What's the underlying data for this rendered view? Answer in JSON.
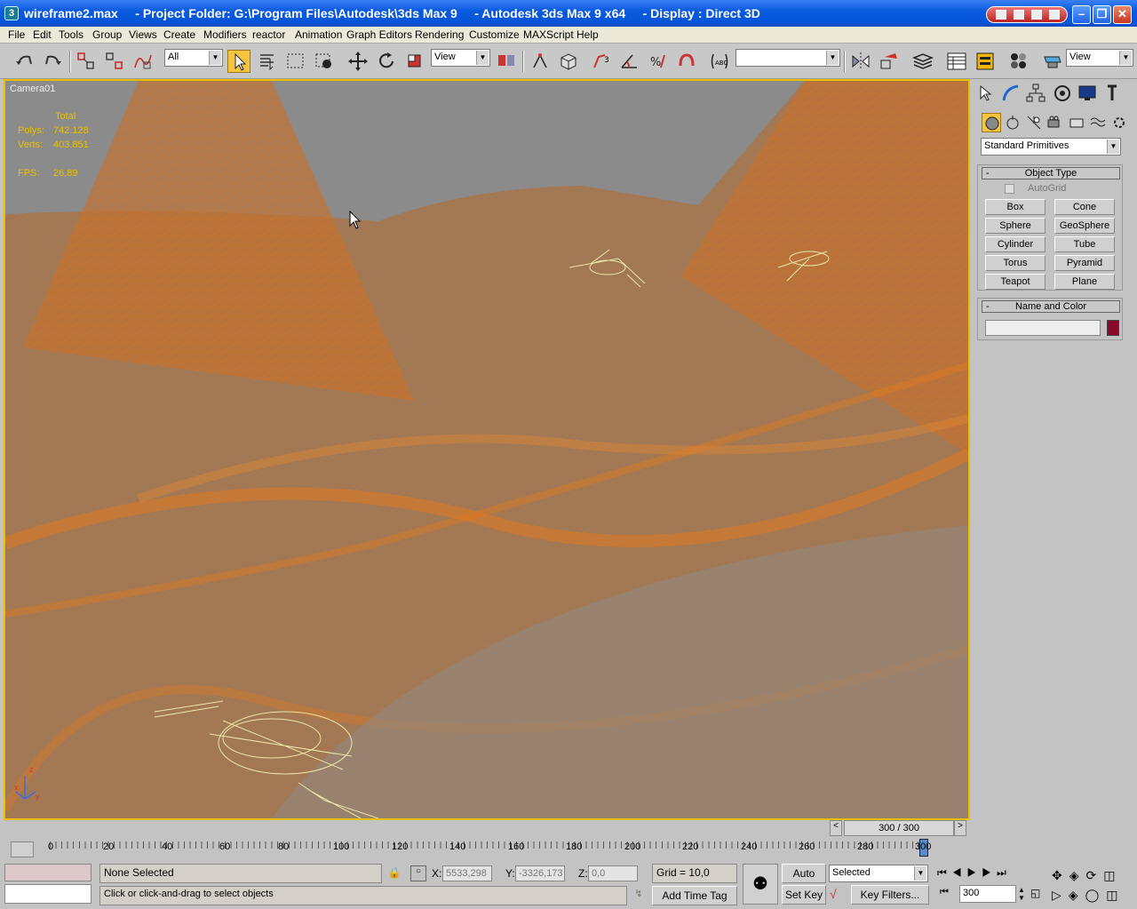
{
  "window": {
    "title": "wireframe2.max     - Project Folder: G:\\Program Files\\Autodesk\\3ds Max 9     - Autodesk 3ds Max 9 x64     - Display : Direct 3D"
  },
  "menu": [
    "File",
    "Edit",
    "Tools",
    "Group",
    "Views",
    "Create",
    "Modifiers",
    "reactor",
    "Animation",
    "Graph Editors",
    "Rendering",
    "Customize",
    "MAXScript",
    "Help"
  ],
  "toolbar": {
    "selection_filter": "All",
    "reference_coord": "View",
    "named_selection": "",
    "viewport_dropdown": "View"
  },
  "viewport": {
    "label": "Camera01",
    "stats": {
      "header": "Total",
      "polys_label": "Polys:",
      "polys_value": "742.128",
      "verts_label": "Verts:",
      "verts_value": "403.851",
      "fps_label": "FPS:",
      "fps_value": "26,89"
    },
    "axis": {
      "z": "z",
      "x": "x",
      "y": "y"
    }
  },
  "command_panel": {
    "category": "Standard Primitives",
    "object_type_header": "Object Type",
    "autogrid": "AutoGrid",
    "buttons": [
      "Box",
      "Cone",
      "Sphere",
      "GeoSphere",
      "Cylinder",
      "Tube",
      "Torus",
      "Pyramid",
      "Teapot",
      "Plane"
    ],
    "name_color_header": "Name and Color",
    "name_value": "",
    "swatch_color": "#8a0a2e"
  },
  "time": {
    "frame_display": "300 / 300",
    "ticks": [
      "0",
      "20",
      "40",
      "60",
      "80",
      "100",
      "120",
      "140",
      "160",
      "180",
      "200",
      "220",
      "240",
      "260",
      "280",
      "300"
    ],
    "current_frame": "300"
  },
  "status": {
    "selection": "None Selected",
    "prompt": "Click or click-and-drag to select objects",
    "x_label": "X:",
    "x_value": "5533,298",
    "y_label": "Y:",
    "y_value": "-3326,173",
    "z_label": "Z:",
    "z_value": "0,0",
    "grid": "Grid = 10,0",
    "add_time_tag": "Add Time Tag",
    "auto_key": "Auto Key",
    "set_key": "Set Key",
    "key_mode": "Selected",
    "key_filters": "Key Filters..."
  },
  "colors": {
    "viewport_bg": "#8c8c8c",
    "wire": "#e07a20",
    "stats": "#e8c000",
    "ships": "#e8e4a8"
  }
}
